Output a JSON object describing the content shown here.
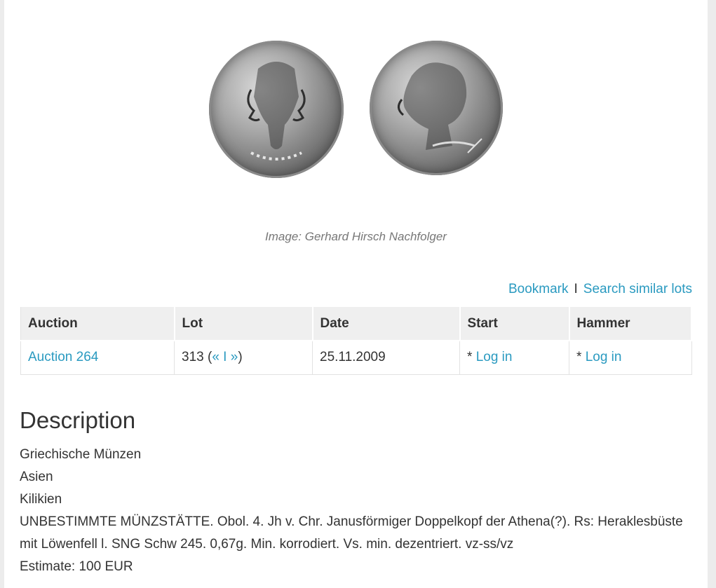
{
  "image": {
    "caption": "Image: Gerhard Hirsch Nachfolger"
  },
  "actions": {
    "bookmark": "Bookmark",
    "separator": "I",
    "search_similar": "Search similar lots"
  },
  "table": {
    "headers": [
      "Auction",
      "Lot",
      "Date",
      "Start",
      "Hammer"
    ],
    "row": {
      "auction": "Auction 264",
      "lot_number": "313 (",
      "prev": "«",
      "lot_sep": " I ",
      "next": "»",
      "lot_close": ")",
      "date": "25.11.2009",
      "start_prefix": "* ",
      "start_link": "Log in",
      "hammer_prefix": "* ",
      "hammer_link": "Log in"
    }
  },
  "description": {
    "heading": "Description",
    "lines": [
      "Griechische Münzen",
      "Asien",
      "Kilikien",
      "UNBESTIMMTE MÜNZSTÄTTE. Obol. 4. Jh v. Chr. Janusförmiger Doppelkopf der Athena(?). Rs: Heraklesbüste mit Löwenfell l. SNG Schw 245. 0,67g. Min. korrodiert. Vs. min. dezentriert. vz-ss/vz",
      "Estimate: 100 EUR"
    ]
  },
  "colors": {
    "link": "#2a9ac0",
    "header_bg": "#efefef",
    "text": "#333333"
  }
}
